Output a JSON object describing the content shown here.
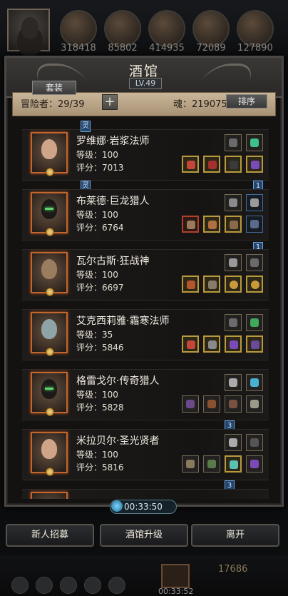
{
  "resources": {
    "values": [
      "318418",
      "85802",
      "414935",
      "72089",
      "127890"
    ]
  },
  "panel": {
    "title": "酒馆",
    "level": "LV.49",
    "set_button": "套装",
    "adventurers_label": "冒险者：29/39",
    "plus": "+",
    "soul_label": "魂：219075",
    "sort_button": "排序"
  },
  "heroes": [
    {
      "name": "罗维娜·岩浆法师",
      "level": "等级：100",
      "score": "评分：7013",
      "tag_above": "灵"
    },
    {
      "name": "布莱德·巨龙猎人",
      "level": "等级：100",
      "score": "评分：6764",
      "tag_above": "灵",
      "tag_right": "1"
    },
    {
      "name": "瓦尔古斯·狂战神",
      "level": "等级：100",
      "score": "评分：6697",
      "tag_right": "1"
    },
    {
      "name": "艾克西莉雅·霜寒法师",
      "level": "等级：35",
      "score": "评分：5846"
    },
    {
      "name": "格雷戈尔·传奇猎人",
      "level": "等级：100",
      "score": "评分：5828"
    },
    {
      "name": "米拉贝尔·圣光贤者",
      "level": "等级：100",
      "score": "评分：5816",
      "tag_above": "3"
    }
  ],
  "last_tag": "3",
  "timer": "00:33:50",
  "buttons": {
    "recruit": "新人招募",
    "upgrade": "酒馆升级",
    "leave": "离开"
  },
  "footer": {
    "gold": "17686",
    "timer": "00:33:52"
  },
  "colors": {
    "parchment": "#bfa98b",
    "portrait_border": "#c0662f",
    "slot_gold": "#b89a3c"
  }
}
